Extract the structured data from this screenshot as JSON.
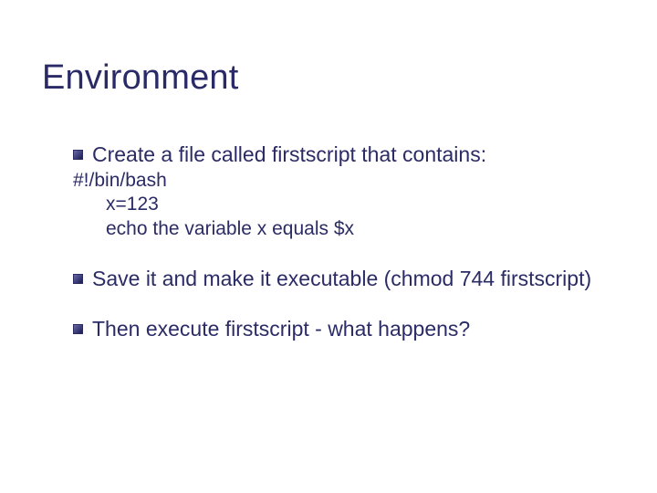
{
  "title": "Environment",
  "items": [
    {
      "text": "Create a file called firstscript that contains:"
    },
    {
      "text": "Save it and make it executable (chmod 744 firstscript)"
    },
    {
      "text": "Then execute firstscript - what happens?"
    }
  ],
  "code": {
    "line1": "#!/bin/bash",
    "line2": "x=123",
    "line3": "echo the variable x equals $x"
  }
}
